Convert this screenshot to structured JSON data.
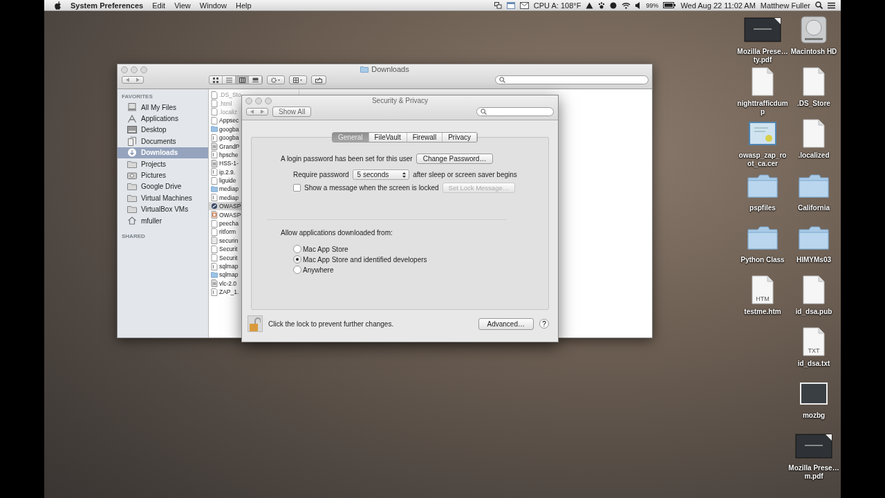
{
  "menu_bar": {
    "app_name": "System Preferences",
    "menus": [
      "Edit",
      "View",
      "Window",
      "Help"
    ],
    "cpu_temp": "CPU A: 108°F",
    "battery": "99%",
    "datetime": "Wed Aug 22  11:02 AM",
    "user": "Matthew Fuller"
  },
  "finder": {
    "title": "Downloads",
    "view_modes": [
      {
        "kind": "icons",
        "selected": false
      },
      {
        "kind": "list",
        "selected": false
      },
      {
        "kind": "columns",
        "selected": true
      },
      {
        "kind": "coverflow",
        "selected": false
      }
    ],
    "sidebar": {
      "favorites_heading": "FAVORITES",
      "shared_heading": "SHARED",
      "items": [
        {
          "label": "All My Files",
          "kind": "files",
          "selected": false
        },
        {
          "label": "Applications",
          "kind": "apps",
          "selected": false
        },
        {
          "label": "Desktop",
          "kind": "desktop",
          "selected": false
        },
        {
          "label": "Documents",
          "kind": "documents",
          "selected": false
        },
        {
          "label": "Downloads",
          "kind": "downloads",
          "selected": true
        },
        {
          "label": "Projects",
          "kind": "folder",
          "selected": false
        },
        {
          "label": "Pictures",
          "kind": "pictures",
          "selected": false
        },
        {
          "label": "Google Drive",
          "kind": "folder",
          "selected": false
        },
        {
          "label": "Virtual Machines",
          "kind": "folder",
          "selected": false
        },
        {
          "label": "VirtualBox VMs",
          "kind": "folder",
          "selected": false
        },
        {
          "label": "mfuller",
          "kind": "home",
          "selected": false
        }
      ]
    },
    "files": [
      {
        "name": ".DS_Sto",
        "kind": "document",
        "hidden": true,
        "selected": false
      },
      {
        "name": ".html",
        "kind": "document",
        "hidden": true,
        "selected": false
      },
      {
        "name": ".localiz",
        "kind": "document",
        "hidden": true,
        "selected": false
      },
      {
        "name": "Appsec",
        "kind": "document",
        "hidden": false,
        "selected": false
      },
      {
        "name": "googba",
        "kind": "folder",
        "hidden": false,
        "selected": false
      },
      {
        "name": "googba",
        "kind": "script",
        "hidden": false,
        "selected": false
      },
      {
        "name": "GrandP",
        "kind": "archive",
        "hidden": false,
        "selected": false
      },
      {
        "name": "hpsche",
        "kind": "script",
        "hidden": false,
        "selected": false
      },
      {
        "name": "HSS-1-",
        "kind": "archive",
        "hidden": false,
        "selected": false
      },
      {
        "name": "ip.2.9.",
        "kind": "script",
        "hidden": false,
        "selected": false
      },
      {
        "name": "liguide",
        "kind": "document",
        "hidden": false,
        "selected": false
      },
      {
        "name": "mediap",
        "kind": "folder",
        "hidden": false,
        "selected": false
      },
      {
        "name": "mediap",
        "kind": "script",
        "hidden": false,
        "selected": false
      },
      {
        "name": "OWASP",
        "kind": "app",
        "hidden": false,
        "selected": true
      },
      {
        "name": "OWASP",
        "kind": "package",
        "hidden": false,
        "selected": false
      },
      {
        "name": "peecha",
        "kind": "document",
        "hidden": false,
        "selected": false
      },
      {
        "name": "ritform",
        "kind": "document",
        "hidden": false,
        "selected": false
      },
      {
        "name": "securin",
        "kind": "image",
        "hidden": false,
        "selected": false
      },
      {
        "name": "Securit",
        "kind": "document",
        "hidden": false,
        "selected": false
      },
      {
        "name": "Securit",
        "kind": "document",
        "hidden": false,
        "selected": false
      },
      {
        "name": "sqlmap",
        "kind": "script",
        "hidden": false,
        "selected": false
      },
      {
        "name": "sqlmap",
        "kind": "folder",
        "hidden": false,
        "selected": false
      },
      {
        "name": "vlc-2.0",
        "kind": "archive",
        "hidden": false,
        "selected": false
      },
      {
        "name": "ZAP_1.",
        "kind": "script",
        "hidden": false,
        "selected": false
      }
    ]
  },
  "dialog": {
    "title": "Security & Privacy",
    "show_all": "Show All",
    "tabs": [
      {
        "label": "General",
        "selected": true
      },
      {
        "label": "FileVault",
        "selected": false
      },
      {
        "label": "Firewall",
        "selected": false
      },
      {
        "label": "Privacy",
        "selected": false
      }
    ],
    "login_text": "A login password has been set for this user",
    "change_password": "Change Password…",
    "require_label": "Require password",
    "require_value": "5 seconds",
    "require_suffix": "after sleep or screen saver begins",
    "lock_message": {
      "label": "Show a message when the screen is locked",
      "checked": false
    },
    "set_lock_button": {
      "label": "Set Lock Message…",
      "disabled": true
    },
    "allow_heading": "Allow applications downloaded from:",
    "sources": [
      {
        "label": "Mac App Store",
        "selected": false
      },
      {
        "label": "Mac App Store and identified developers",
        "selected": true
      },
      {
        "label": "Anywhere",
        "selected": false
      }
    ],
    "locked": false,
    "lock_text": "Click the lock to prevent further changes.",
    "advanced": "Advanced…",
    "help": "?"
  },
  "desktop_icons": [
    {
      "label": "Mozilla Prese…ty.pdf",
      "kind": "presentation"
    },
    {
      "label": "Macintosh HD",
      "kind": "disk"
    },
    {
      "label": "nighttrafficdump",
      "kind": "document"
    },
    {
      "label": ".DS_Store",
      "kind": "document"
    },
    {
      "label": "owasp_zap_root_ca.cer",
      "kind": "certificate"
    },
    {
      "label": ".localized",
      "kind": "document"
    },
    {
      "label": "pspfiles",
      "kind": "folder"
    },
    {
      "label": "California",
      "kind": "folder"
    },
    {
      "label": "Python Class",
      "kind": "folder"
    },
    {
      "label": "HIMYMs03",
      "kind": "folder"
    },
    {
      "label": "testme.htm",
      "kind": "document",
      "badge": "HTM"
    },
    {
      "label": "id_dsa.pub",
      "kind": "document"
    },
    {
      "label": "id_dsa.txt",
      "kind": "document",
      "badge": "TXT"
    },
    {
      "label": "mozbg",
      "kind": "image"
    },
    {
      "label": "Mozilla Prese…m.pdf",
      "kind": "presentation"
    }
  ]
}
